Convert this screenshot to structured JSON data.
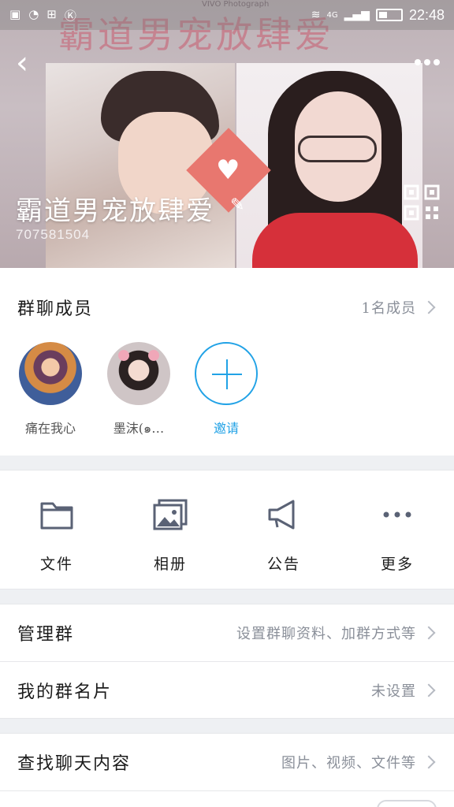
{
  "statusbar": {
    "time": "22:48",
    "network": "4G"
  },
  "header": {
    "banner_text": "霸道男宠放肆爱",
    "banner_small": "VIVO Photograph",
    "group_name": "霸道男宠放肆爱",
    "group_id": "707581504"
  },
  "members": {
    "title": "群聊成员",
    "count": "1名成员",
    "list": [
      {
        "name": "痛在我心"
      },
      {
        "name": "墨沫(๑…"
      }
    ],
    "invite_label": "邀请"
  },
  "tools": [
    {
      "label": "文件",
      "icon": "folder-icon"
    },
    {
      "label": "相册",
      "icon": "album-icon"
    },
    {
      "label": "公告",
      "icon": "megaphone-icon"
    },
    {
      "label": "更多",
      "icon": "more-icon"
    }
  ],
  "settings": {
    "manage": {
      "label": "管理群",
      "value": "设置群聊资料、加群方式等"
    },
    "card": {
      "label": "我的群名片",
      "value": "未设置"
    },
    "search": {
      "label": "查找聊天内容",
      "value": "图片、视频、文件等"
    }
  },
  "colors": {
    "accent": "#21a2e6",
    "background": "#eef0f3",
    "icon_gray": "#5a6275"
  }
}
